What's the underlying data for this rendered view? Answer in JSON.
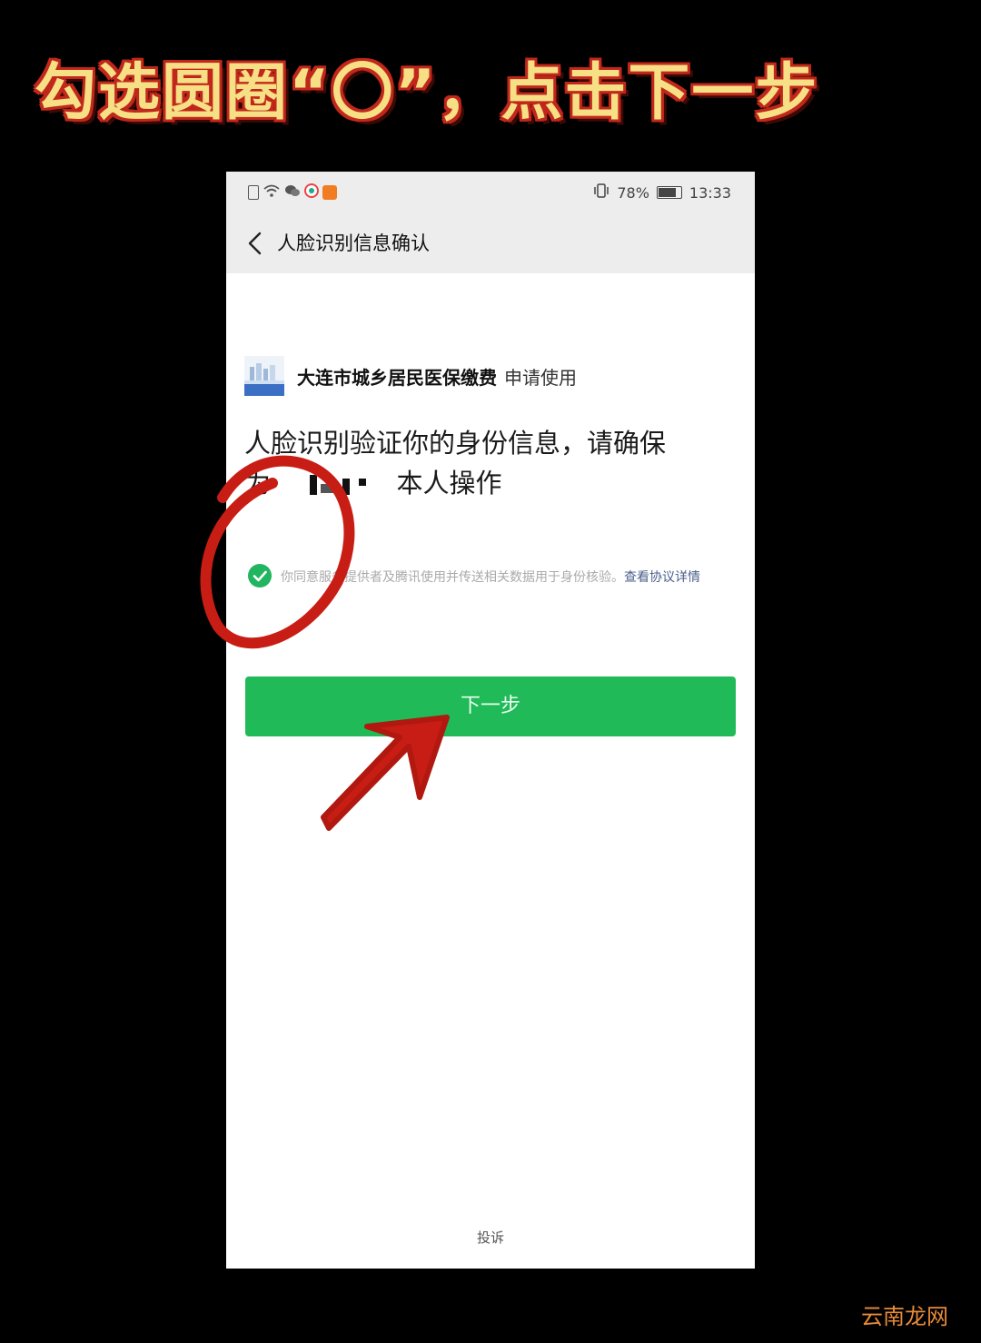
{
  "caption": "勾选圆圈“〇”，点击下一步",
  "status_bar": {
    "battery": "78%",
    "time": "13:33"
  },
  "nav": {
    "title": "人脸识别信息确认"
  },
  "app": {
    "name": "大连市城乡居民医保缴费",
    "suffix": "申请使用"
  },
  "headline": {
    "line1": "人脸识别验证你的身份信息，请确保",
    "prefix": "为",
    "suffix": "本人操作"
  },
  "agreement": {
    "checked": true,
    "text": "你同意服务提供者及腾讯使用并传送相关数据用于身份核验。",
    "link": "查看协议详情"
  },
  "next_button": "下一步",
  "complain_link": "投诉",
  "watermark": "云南龙网",
  "colors": {
    "primary_green": "#20ba58",
    "annotation_red": "#c81d14",
    "caption_yellow": "#f6df84"
  }
}
